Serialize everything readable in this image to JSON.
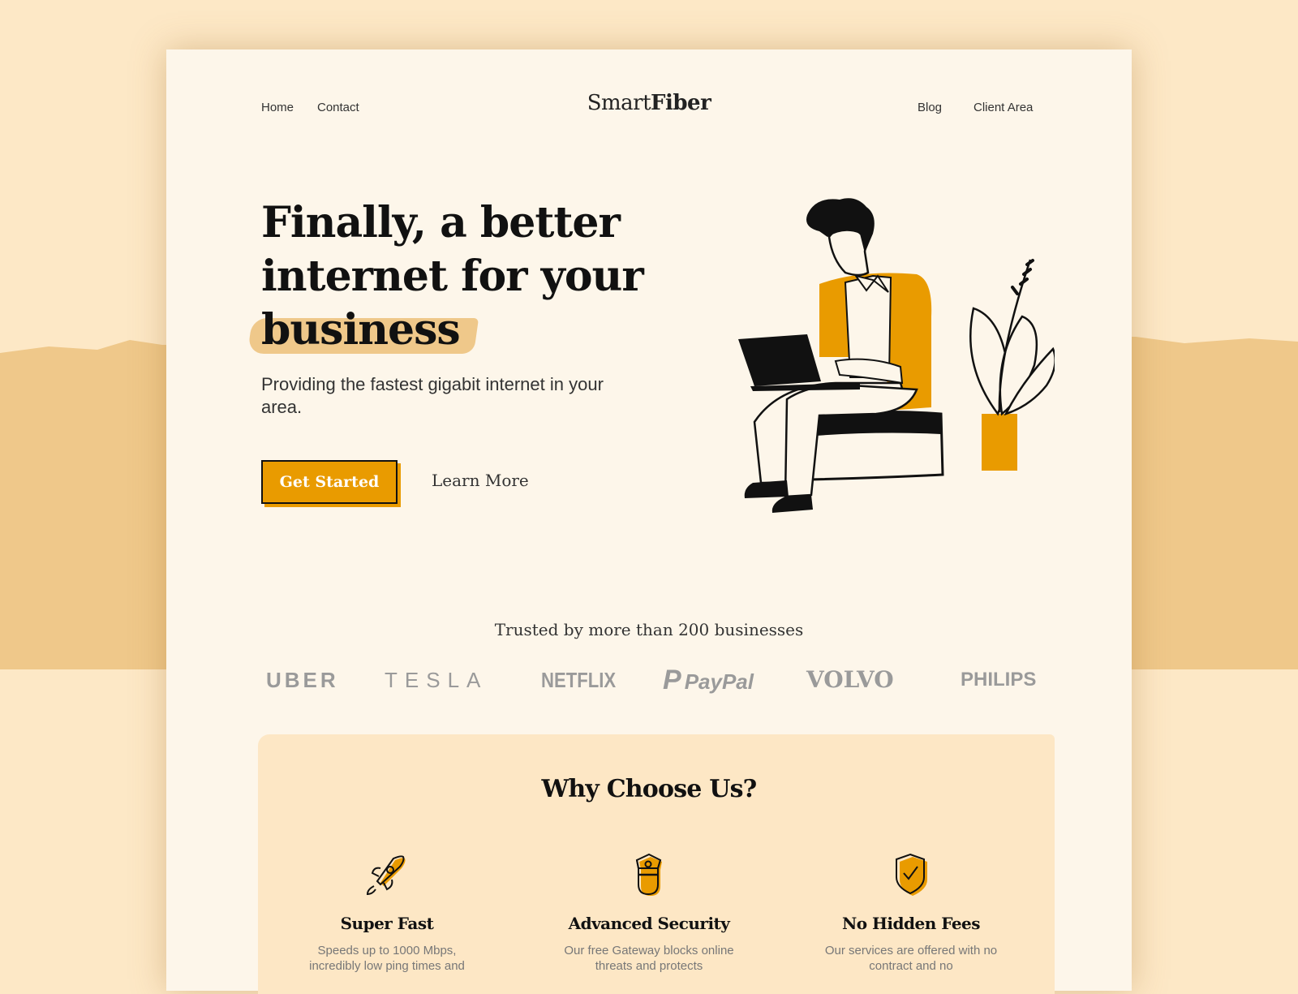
{
  "brand": {
    "name_light": "Smart",
    "name_bold": "Fiber"
  },
  "nav": {
    "left": [
      {
        "label": "Home"
      },
      {
        "label": "Contact"
      }
    ],
    "right": [
      {
        "label": "Blog"
      },
      {
        "label": "Client Area"
      }
    ]
  },
  "hero": {
    "headline_lines": [
      "Finally, a better",
      "internet for your",
      "business"
    ],
    "highlighted_word": "business",
    "subtitle": "Providing the fastest gigabit internet in your area.",
    "primary_cta": "Get Started",
    "secondary_cta": "Learn More",
    "illustration": "man-with-laptop-and-plant"
  },
  "trusted": {
    "text": "Trusted by more than 200 businesses",
    "logos": [
      "UBER",
      "TESLA",
      "NETFLIX",
      "PayPal",
      "VOLVO",
      "PHILIPS"
    ]
  },
  "why": {
    "title": "Why Choose Us?",
    "features": [
      {
        "icon": "rocket-icon",
        "title": "Super Fast",
        "description": "Speeds up to 1000 Mbps, incredibly low ping times and"
      },
      {
        "icon": "security-guard-icon",
        "title": "Advanced Security",
        "description": "Our free Gateway blocks online threats and protects"
      },
      {
        "icon": "shield-check-icon",
        "title": "No Hidden Fees",
        "description": "Our services are offered with no contract and no"
      }
    ]
  },
  "colors": {
    "accent": "#e99b00",
    "highlight": "#efc88a",
    "page_bg": "#fdf6ea",
    "outer_bg": "#fde8c6",
    "panel_bg": "#fde7c5"
  }
}
